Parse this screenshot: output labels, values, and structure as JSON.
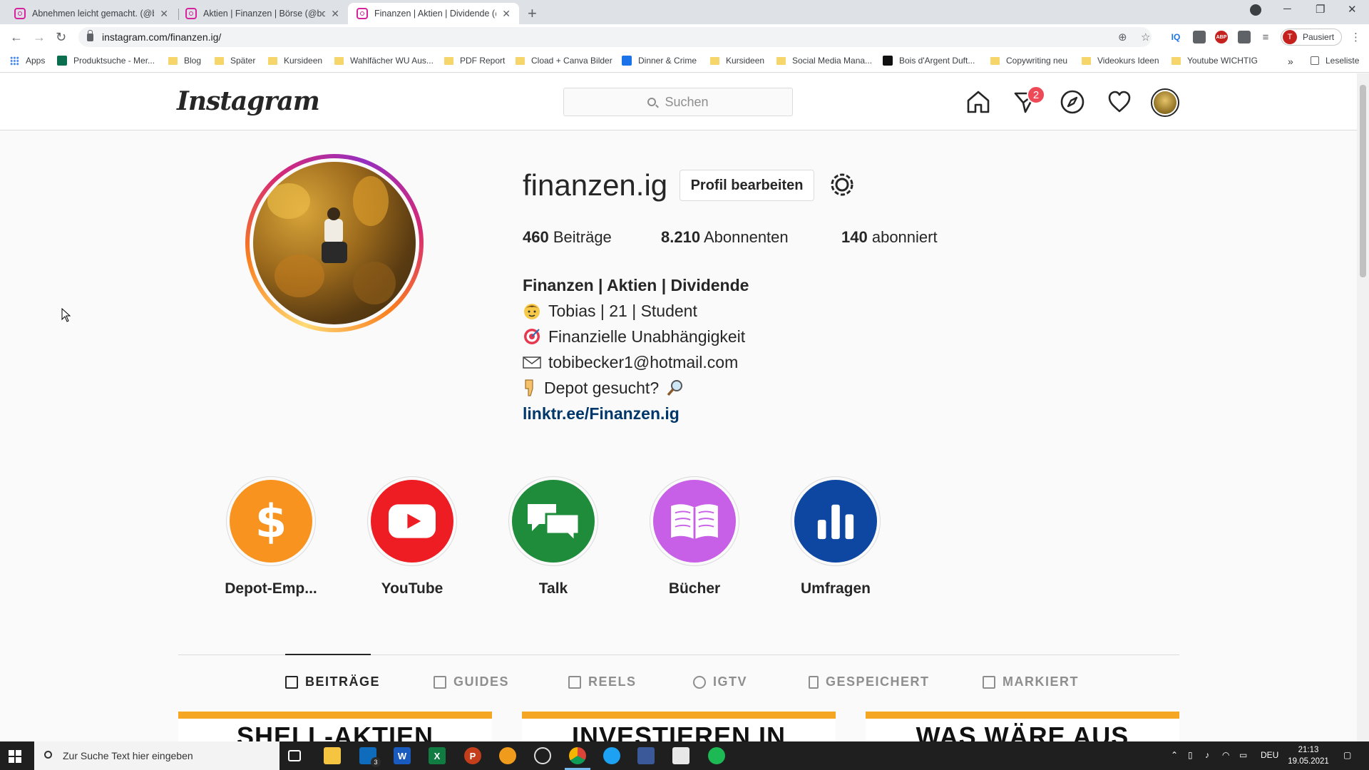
{
  "browser": {
    "tabs": [
      {
        "title": "Abnehmen leicht gemacht. (@bo"
      },
      {
        "title": "Aktien | Finanzen | Börse (@boer"
      },
      {
        "title": "Finanzen | Aktien | Dividende (@"
      }
    ],
    "url": "instagram.com/finanzen.ig/",
    "profile_label": "Pausiert",
    "profile_initial": "T",
    "bookmarks": [
      "Apps",
      "Produktsuche - Mer...",
      "Blog",
      "Später",
      "Kursideen",
      "Wahlfächer WU Aus...",
      "PDF Report",
      "Cload + Canva Bilder",
      "Dinner & Crime",
      "Kursideen",
      "Social Media Mana...",
      "Bois d'Argent Duft...",
      "Copywriting neu",
      "Videokurs Ideen",
      "Youtube WICHTIG"
    ],
    "reading_list": "Leseliste",
    "more_bookmarks": "»"
  },
  "instagram": {
    "logo": "Instagram",
    "search_placeholder": "Suchen",
    "dm_badge": "2",
    "profile": {
      "username": "finanzen.ig",
      "edit_button": "Profil bearbeiten",
      "stats": {
        "posts_count": "460",
        "posts_label": "Beiträge",
        "followers_count": "8.210",
        "followers_label": "Abonnenten",
        "following_count": "140",
        "following_label": "abonniert"
      },
      "bio": {
        "name": "Finanzen | Aktien | Dividende",
        "line1": "Tobias | 21 | Student",
        "line2": "Finanzielle Unabhängigkeit",
        "line3": "tobibecker1@hotmail.com",
        "line4": "Depot gesucht?",
        "link": "linktr.ee/Finanzen.ig"
      }
    },
    "highlights": [
      {
        "label": "Depot-Emp...",
        "color": "#f7931e",
        "icon": "dollar-icon"
      },
      {
        "label": "YouTube",
        "color": "#ee1d23",
        "icon": "youtube-play-icon"
      },
      {
        "label": "Talk",
        "color": "#1e8c3a",
        "icon": "chat-bubbles-icon"
      },
      {
        "label": "Bücher",
        "color": "#c760e6",
        "icon": "open-book-icon"
      },
      {
        "label": "Umfragen",
        "color": "#0d47a1",
        "icon": "bar-chart-icon"
      }
    ],
    "tabs": [
      "BEITRÄGE",
      "GUIDES",
      "REELS",
      "IGTV",
      "GESPEICHERT",
      "MARKIERT"
    ],
    "posts": [
      "SHELL-AKTIEN",
      "INVESTIEREN IN",
      "WAS WÄRE AUS"
    ]
  },
  "taskbar": {
    "search_placeholder": "Zur Suche Text hier eingeben",
    "mail_badge": "3",
    "language": "DEU",
    "time": "21:13",
    "date": "19.05.2021"
  }
}
